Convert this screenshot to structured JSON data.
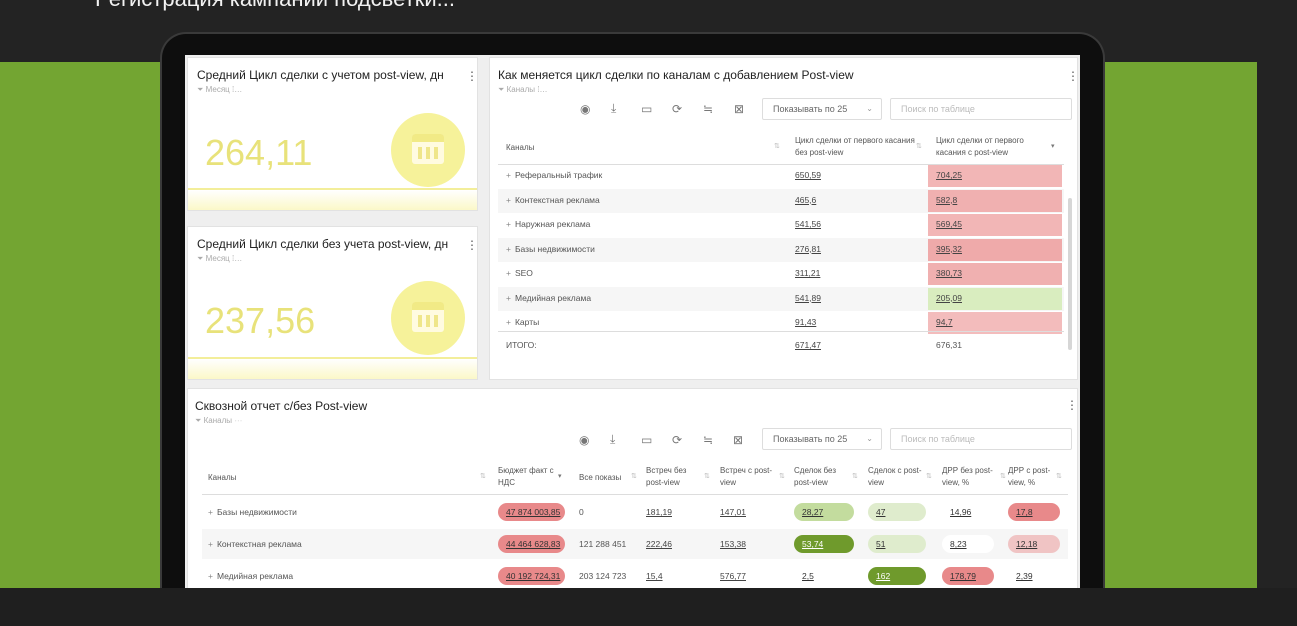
{
  "slide_heading": "Регистрация кампании подсветки...",
  "kpi_cards": [
    {
      "title": "Средний Цикл сделки с учетом post-view, дн",
      "filter": "Месяц",
      "value": "264,11"
    },
    {
      "title": "Средний Цикл сделки без учета post-view, дн",
      "filter": "Месяц",
      "value": "237,56"
    }
  ],
  "channel_table": {
    "title": "Как меняется цикл сделки по каналам с добавлением Post-view",
    "filter": "Каналы",
    "pager": "Показывать по 25",
    "search_placeholder": "Поиск по таблице",
    "headers": [
      "Каналы",
      "Цикл сделки от первого касания без post-view",
      "Цикл сделки от первого касания с post-view"
    ],
    "rows": [
      {
        "name": "Реферальный трафик",
        "without": "650,59",
        "with": "704,25",
        "color": "#f2b6b6"
      },
      {
        "name": "Контекстная реклама",
        "without": "465,6",
        "with": "582,8",
        "color": "#f0b0b0"
      },
      {
        "name": "Наружная реклама",
        "without": "541,56",
        "with": "569,45",
        "color": "#f2b6b6"
      },
      {
        "name": "Базы недвижимости",
        "without": "276,81",
        "with": "395,32",
        "color": "#efaaaa"
      },
      {
        "name": "SEO",
        "without": "311,21",
        "with": "380,73",
        "color": "#f0b0b0"
      },
      {
        "name": "Медийная реклама",
        "without": "541,89",
        "with": "205,09",
        "color": "#d9edbf"
      },
      {
        "name": "Карты",
        "without": "91,43",
        "with": "94,7",
        "color": "#f3bcbc"
      }
    ],
    "total_label": "ИТОГО:",
    "total_without": "671,47",
    "total_with": "676,31"
  },
  "report": {
    "title": "Сквозной отчет с/без Post-view",
    "filter": "Каналы",
    "pager": "Показывать по 25",
    "search_placeholder": "Поиск по таблице",
    "headers": [
      "Каналы",
      "Бюджет факт с НДС",
      "Все показы",
      "Встреч без post-view",
      "Встреч с post-view",
      "Сделок без post-view",
      "Сделок с post-view",
      "ДРР без post-view, %",
      "ДРР с post-view, %"
    ],
    "rows": [
      {
        "name": "Базы недвижимости",
        "budget": "47 874 003,85",
        "shows": "0",
        "meet_without": "181,19",
        "meet_with": "147,01",
        "deals_without": "28,27",
        "deals_with": "47",
        "drr_without": "14,96",
        "drr_with": "17,8"
      },
      {
        "name": "Контекстная реклама",
        "budget": "44 464 628,83",
        "shows": "121 288 451",
        "meet_without": "222,46",
        "meet_with": "153,38",
        "deals_without": "53,74",
        "deals_with": "51",
        "drr_without": "8,23",
        "drr_with": "12,18"
      },
      {
        "name": "Медийная реклама",
        "budget": "40 192 724,31",
        "shows": "203 124 723",
        "meet_without": "15,4",
        "meet_with": "576,77",
        "deals_without": "2,5",
        "deals_with": "162",
        "drr_without": "178,79",
        "drr_with": "2,39"
      }
    ]
  },
  "colors": {
    "background_green": "#73a532",
    "kpi_yellow": "#e8e27a",
    "heat_red": "#f2b6b6",
    "heat_green": "#d9edbf"
  }
}
